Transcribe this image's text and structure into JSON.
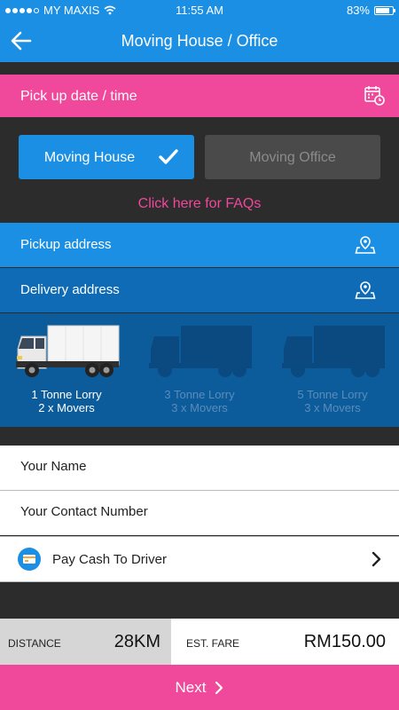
{
  "status_bar": {
    "carrier": "MY MAXIS",
    "time": "11:55 AM",
    "battery_text": "83%",
    "battery_level": 0.83,
    "signal_dots": 4
  },
  "header": {
    "title": "Moving House / Office",
    "back_icon": "arrow-left-icon"
  },
  "pickup_date": {
    "label": "Pick up date / time",
    "icon": "calendar-clock-icon"
  },
  "tabs": [
    {
      "label": "Moving House",
      "selected": true
    },
    {
      "label": "Moving Office",
      "selected": false
    }
  ],
  "faq_link": "Click here for FAQs",
  "addresses": {
    "pickup": "Pickup address",
    "delivery": "Delivery address"
  },
  "vehicles": [
    {
      "name": "1 Tonne Lorry",
      "movers": "2 x Movers",
      "selected": true
    },
    {
      "name": "3 Tonne Lorry",
      "movers": "3 x Movers",
      "selected": false
    },
    {
      "name": "5 Tonne Lorry",
      "movers": "3 x Movers",
      "selected": false
    }
  ],
  "form": {
    "name_placeholder": "Your Name",
    "contact_placeholder": "Your Contact Number",
    "payment_label": "Pay Cash To Driver"
  },
  "fare": {
    "distance_caption": "DISTANCE",
    "distance_value": "28KM",
    "fare_caption": "EST. FARE",
    "fare_value": "RM150.00"
  },
  "next_button": "Next",
  "colors": {
    "primary_blue": "#1b8fe3",
    "pink": "#f0489b",
    "dark_bg": "#2c2c2c",
    "navy": "#0c5c9c"
  }
}
